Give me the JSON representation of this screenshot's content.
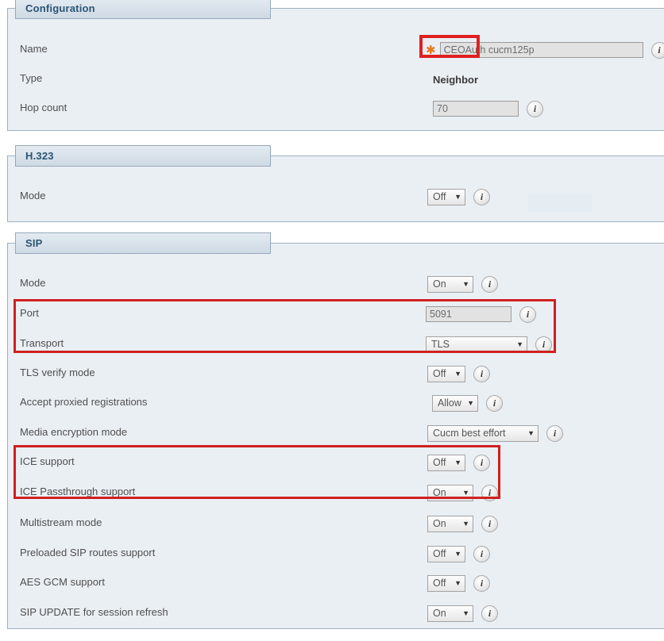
{
  "sections": [
    {
      "id": "configuration",
      "title": "Configuration",
      "rows": [
        {
          "label": "Name",
          "control": "text",
          "value": "CEOAuth cucm125p",
          "required": true,
          "width": "wide",
          "info": "i"
        },
        {
          "label": "Type",
          "control": "static",
          "value": "Neighbor"
        },
        {
          "label": "Hop count",
          "control": "text",
          "value": "70",
          "required": false,
          "width": "small",
          "info": "i"
        }
      ]
    },
    {
      "id": "h323",
      "title": "H.323",
      "rows": [
        {
          "label": "Mode",
          "control": "select",
          "value": "Off",
          "width": "w-sm",
          "info": "i"
        }
      ]
    },
    {
      "id": "sip",
      "title": "SIP",
      "rows": [
        {
          "label": "Mode",
          "control": "select",
          "value": "On",
          "width": "w-md",
          "info": "i"
        },
        {
          "label": "Port",
          "control": "text",
          "value": "5091",
          "width": "small",
          "info": "i"
        },
        {
          "label": "Transport",
          "control": "select",
          "value": "TLS",
          "width": "w-tls",
          "info": "i"
        },
        {
          "label": "TLS verify mode",
          "control": "select",
          "value": "Off",
          "width": "w-sm",
          "info": "i"
        },
        {
          "label": "Accept proxied registrations",
          "control": "select",
          "value": "Allow",
          "width": "w-md",
          "info": "i"
        },
        {
          "label": "Media encryption mode",
          "control": "select",
          "value": "Cucm best effort",
          "width": "w-lg",
          "info": "i"
        },
        {
          "label": "ICE support",
          "control": "select",
          "value": "Off",
          "width": "w-sm",
          "info": "i"
        },
        {
          "label": "ICE Passthrough support",
          "control": "select",
          "value": "On",
          "width": "w-md",
          "info": "i"
        },
        {
          "label": "Multistream mode",
          "control": "select",
          "value": "On",
          "width": "w-md",
          "info": "i"
        },
        {
          "label": "Preloaded SIP routes support",
          "control": "select",
          "value": "Off",
          "width": "w-sm",
          "info": "i"
        },
        {
          "label": "AES GCM support",
          "control": "select",
          "value": "Off",
          "width": "w-sm",
          "info": "i"
        },
        {
          "label": "SIP UPDATE for session refresh",
          "control": "select",
          "value": "On",
          "width": "w-md",
          "info": "i"
        }
      ]
    }
  ],
  "annotations": {
    "name_highlight_text": "CEOAuth",
    "boxes": [
      "name-field-highlight",
      "port-transport-highlight",
      "ice-support-highlight"
    ],
    "color": "#cf2020"
  },
  "colors": {
    "panel_background": "#eaeff4",
    "panel_border": "#9fb1c1",
    "legend_text": "#2b5573",
    "required_star": "#e8791a",
    "annotation_red": "#cf2020"
  },
  "glyphs": {
    "caret_down": "▼",
    "required_star": "✱",
    "info_icon": "i"
  }
}
